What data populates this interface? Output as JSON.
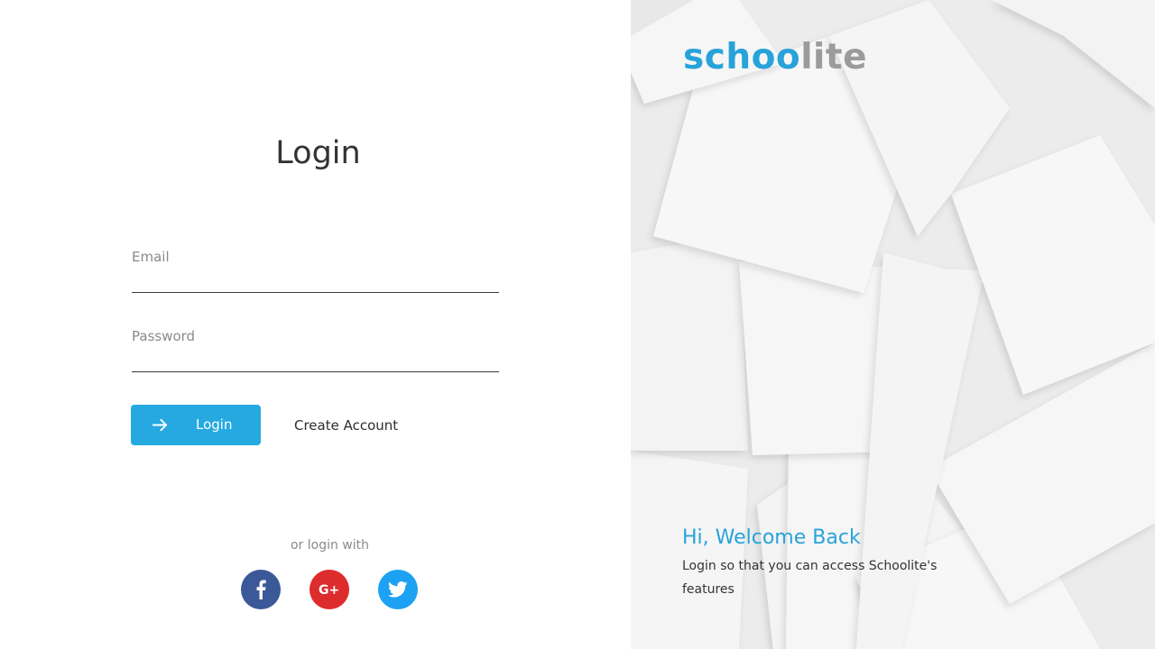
{
  "login": {
    "title": "Login",
    "email_label": "Email",
    "email_value": "",
    "password_label": "Password",
    "password_value": "",
    "login_button": "Login",
    "create_account": "Create Account",
    "or_login_with": "or login with",
    "social": [
      {
        "name": "facebook",
        "icon": "facebook-icon",
        "color": "#3b5998"
      },
      {
        "name": "google-plus",
        "icon": "google-plus-icon",
        "label": "G+",
        "color": "#dd2c2c"
      },
      {
        "name": "twitter",
        "icon": "twitter-icon",
        "color": "#1da1f2"
      }
    ]
  },
  "brand": {
    "logo_part1": "schoo",
    "logo_part2": "lite",
    "accent_color": "#27a3da",
    "logo_secondary_color": "#9b9b9b"
  },
  "welcome": {
    "heading": "Hi, Welcome Back",
    "text": "Login so that  you can access Schoolite's features"
  },
  "colors": {
    "button": "#26a9e1"
  }
}
